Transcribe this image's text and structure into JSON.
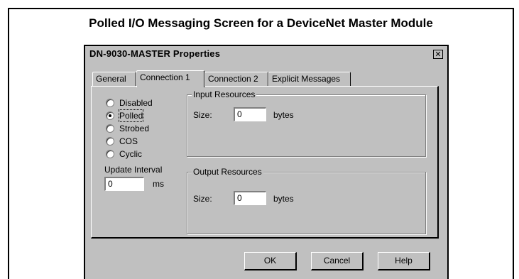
{
  "figure": {
    "caption": "Polled I/O Messaging Screen for a DeviceNet Master Module"
  },
  "dialog": {
    "title": "DN-9030-MASTER Properties",
    "close_glyph": "✕",
    "tabs": [
      {
        "label": "General",
        "active": false
      },
      {
        "label": "Connection 1",
        "active": true
      },
      {
        "label": "Connection 2",
        "active": false
      },
      {
        "label": "Explicit Messages",
        "active": false
      }
    ],
    "connection_modes": [
      {
        "label": "Disabled",
        "selected": false
      },
      {
        "label": "Polled",
        "selected": true
      },
      {
        "label": "Strobed",
        "selected": false
      },
      {
        "label": "COS",
        "selected": false
      },
      {
        "label": "Cyclic",
        "selected": false
      }
    ],
    "update_interval": {
      "label": "Update Interval",
      "value": "0",
      "unit": "ms"
    },
    "input_resources": {
      "title": "Input Resources",
      "size_label": "Size:",
      "value": "0",
      "unit": "bytes"
    },
    "output_resources": {
      "title": "Output Resources",
      "size_label": "Size:",
      "value": "0",
      "unit": "bytes"
    },
    "buttons": {
      "ok": "OK",
      "cancel": "Cancel",
      "help": "Help"
    }
  }
}
